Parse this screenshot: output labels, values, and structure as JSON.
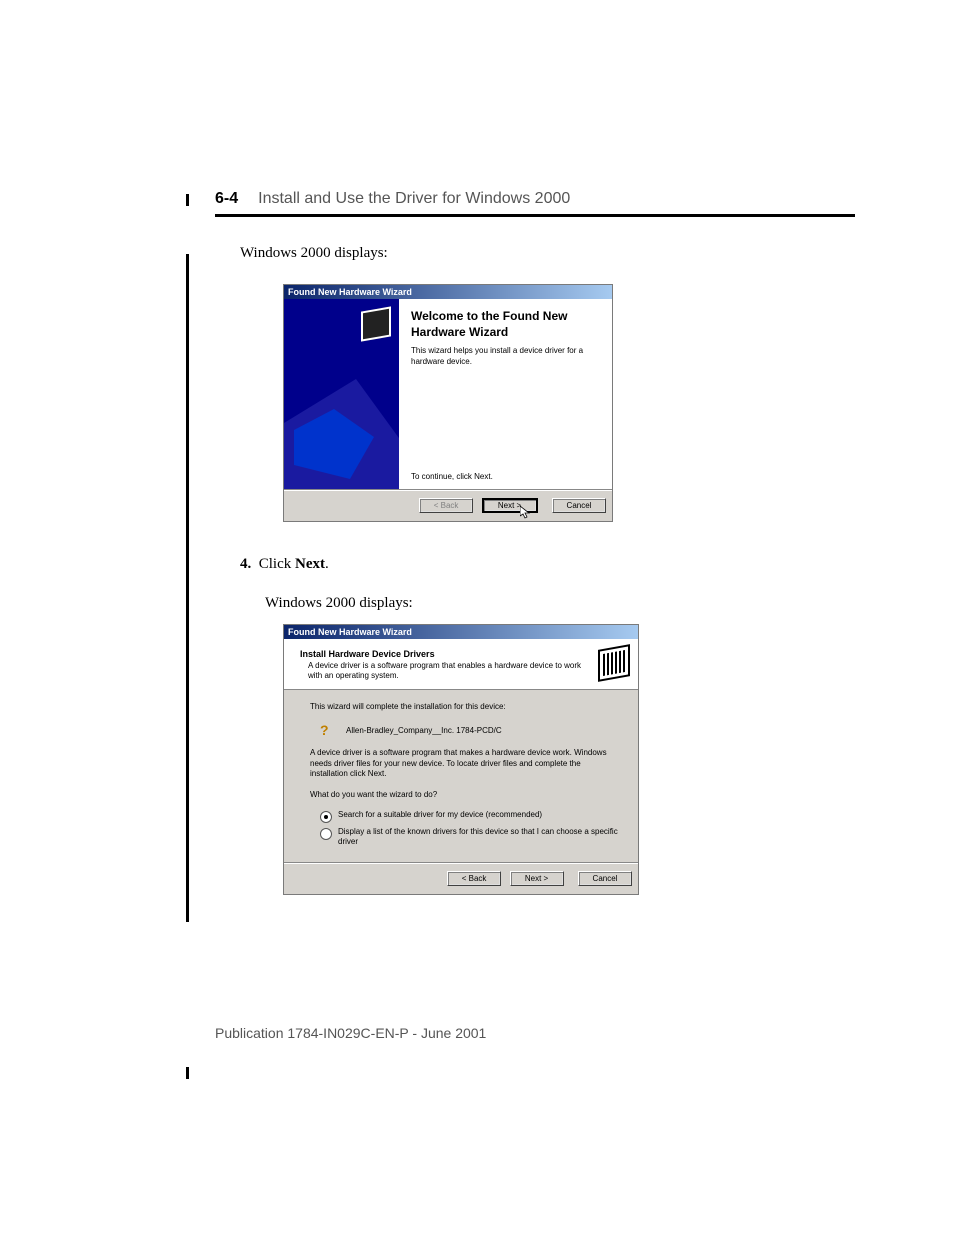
{
  "header": {
    "page_num": "6-4",
    "chapter_title": "Install and Use the Driver for Windows 2000"
  },
  "intro_text": "Windows 2000 displays:",
  "dialog1": {
    "title": "Found New Hardware Wizard",
    "heading": "Welcome to the Found New Hardware Wizard",
    "desc": "This wizard helps you install a device driver for a hardware device.",
    "continue": "To continue, click Next.",
    "buttons": {
      "back": "< Back",
      "next": "Next >",
      "cancel": "Cancel"
    }
  },
  "step4": {
    "num": "4.",
    "pre": "Click ",
    "bold": "Next",
    "post": "."
  },
  "intro_text2": "Windows 2000 displays:",
  "dialog2": {
    "title": "Found New Hardware Wizard",
    "header_title": "Install Hardware Device Drivers",
    "header_desc": "A device driver is a software program that enables a hardware device to work with an operating system.",
    "line1": "This wizard will complete the installation for this device:",
    "device": "Allen-Bradley_Company__Inc. 1784-PCD/C",
    "line2": "A device driver is a software program that makes a hardware device work. Windows needs driver files for your new device. To locate driver files and complete the installation click Next.",
    "question": "What do you want the wizard to do?",
    "opt1": "Search for a suitable driver for my device (recommended)",
    "opt2": "Display a list of the known drivers for this device so that I can choose a specific driver",
    "buttons": {
      "back": "< Back",
      "next": "Next >",
      "cancel": "Cancel"
    }
  },
  "footer": "Publication 1784-IN029C-EN-P - June 2001"
}
